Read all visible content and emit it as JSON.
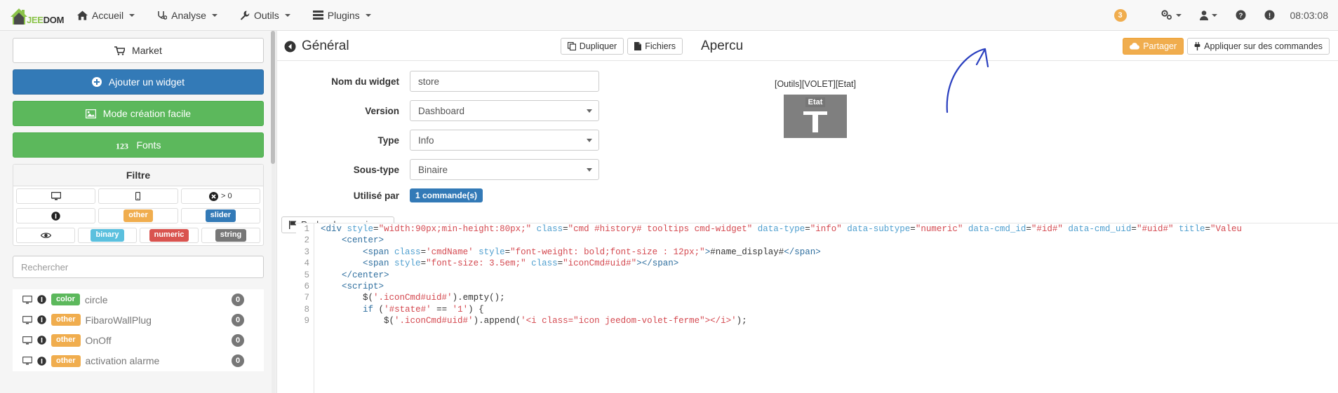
{
  "navbar": {
    "brand": {
      "text_green": "JEE",
      "text_dark": "DOM",
      "icon": "house-logo-icon"
    },
    "items": [
      {
        "label": "Accueil",
        "icon": "home-icon",
        "caret": true
      },
      {
        "label": "Analyse",
        "icon": "stethoscope-icon",
        "caret": true
      },
      {
        "label": "Outils",
        "icon": "wrench-icon",
        "caret": true
      },
      {
        "label": "Plugins",
        "icon": "list-icon",
        "caret": true
      }
    ],
    "notification_count": "3",
    "right_icons": [
      {
        "name": "gears-icon",
        "caret": true
      },
      {
        "name": "user-icon",
        "caret": true
      },
      {
        "name": "question-circle-icon",
        "caret": false
      },
      {
        "name": "exclamation-circle-icon",
        "caret": false
      }
    ],
    "clock": "08:03:08"
  },
  "sidebar": {
    "buttons": [
      {
        "label": "Market",
        "icon": "cart-icon",
        "style": "default"
      },
      {
        "label": "Ajouter un widget",
        "icon": "plus-circle-icon",
        "style": "primary"
      },
      {
        "label": "Mode création facile",
        "icon": "image-icon",
        "style": "success"
      },
      {
        "label": "Fonts",
        "icon": "font-123-icon",
        "style": "success"
      }
    ],
    "filter": {
      "title": "Filtre",
      "rows": [
        [
          {
            "type": "icon",
            "icon": "desktop-icon"
          },
          {
            "type": "icon",
            "icon": "mobile-icon"
          },
          {
            "type": "icon-text",
            "icon": "times-circle-icon",
            "text": "> 0"
          }
        ],
        [
          {
            "type": "icon",
            "icon": "info-circle-icon"
          },
          {
            "type": "label",
            "text": "other",
            "color": "#f0ad4e"
          },
          {
            "type": "label",
            "text": "slider",
            "color": "#337ab7"
          }
        ],
        [
          {
            "type": "icon",
            "icon": "eye-icon"
          },
          {
            "type": "label",
            "text": "binary",
            "color": "#5bc0de"
          },
          {
            "type": "label",
            "text": "numeric",
            "color": "#d9534f"
          },
          {
            "type": "label",
            "text": "string",
            "color": "#777777"
          }
        ]
      ]
    },
    "search": {
      "placeholder": "Rechercher",
      "value": ""
    },
    "widgets": [
      {
        "device_icon": "desktop-icon",
        "type_icon": "info-circle-icon",
        "label": "color",
        "label_color": "#5cb85c",
        "name": "circle",
        "count": "0"
      },
      {
        "device_icon": "desktop-icon",
        "type_icon": "info-circle-icon",
        "label": "other",
        "label_color": "#f0ad4e",
        "name": "FibaroWallPlug",
        "count": "0"
      },
      {
        "device_icon": "desktop-icon",
        "type_icon": "info-circle-icon",
        "label": "other",
        "label_color": "#f0ad4e",
        "name": "OnOff",
        "count": "0"
      },
      {
        "device_icon": "desktop-icon",
        "type_icon": "info-circle-icon",
        "label": "other",
        "label_color": "#f0ad4e",
        "name": "activation alarme",
        "count": "0"
      }
    ]
  },
  "general": {
    "title": "Général",
    "back_icon": "arrow-circle-left-icon",
    "buttons": [
      {
        "label": "Dupliquer",
        "icon": "copy-icon"
      },
      {
        "label": "Fichiers",
        "icon": "file-icon"
      }
    ],
    "fields": [
      {
        "label": "Nom du widget",
        "control": "input",
        "value": "store"
      },
      {
        "label": "Version",
        "control": "select",
        "value": "Dashboard"
      },
      {
        "label": "Type",
        "control": "select",
        "value": "Info"
      },
      {
        "label": "Sous-type",
        "control": "select",
        "value": "Binaire"
      },
      {
        "label": "Utilisé par",
        "control": "badge",
        "value": "1 commande(s)"
      }
    ],
    "icon_search_button": {
      "label": "Rechercher une icone",
      "icon": "flag-icon"
    },
    "code": {
      "lines": [
        {
          "n": "1",
          "html": "<span class=\"ctag\">&lt;div</span> <span class=\"cattr\">style</span><span class=\"cpunct\">=</span><span class=\"cstr\">\"width:90px;min-height:80px;\"</span> <span class=\"cattr\">class</span><span class=\"cpunct\">=</span><span class=\"cstr\">\"cmd #history# tooltips cmd-widget\"</span> <span class=\"cattr\">data-type</span><span class=\"cpunct\">=</span><span class=\"cstr\">\"info\"</span> <span class=\"cattr\">data-subtype</span><span class=\"cpunct\">=</span><span class=\"cstr\">\"numeric\"</span> <span class=\"cattr\">data-cmd_id</span><span class=\"cpunct\">=</span><span class=\"cstr\">\"#id#\"</span> <span class=\"cattr\">data-cmd_uid</span><span class=\"cpunct\">=</span><span class=\"cstr\">\"#uid#\"</span> <span class=\"cattr\">title</span><span class=\"cpunct\">=</span><span class=\"cstr\">\"Valeu</span>"
        },
        {
          "n": "2",
          "html": "    <span class=\"ctag\">&lt;center&gt;</span>"
        },
        {
          "n": "3",
          "html": "        <span class=\"ctag\">&lt;span</span> <span class=\"cattr\">class</span><span class=\"cpunct\">=</span><span class=\"cstr\">'cmdName'</span> <span class=\"cattr\">style</span><span class=\"cpunct\">=</span><span class=\"cstr\">\"font-weight: bold;font-size : 12px;\"</span><span class=\"ctag\">&gt;</span><span class=\"cplain\">#name_display#</span><span class=\"ctag\">&lt;/span&gt;</span>"
        },
        {
          "n": "4",
          "html": "        <span class=\"ctag\">&lt;span</span> <span class=\"cattr\">style</span><span class=\"cpunct\">=</span><span class=\"cstr\">\"font-size: 3.5em;\"</span> <span class=\"cattr\">class</span><span class=\"cpunct\">=</span><span class=\"cstr\">\"iconCmd#uid#\"</span><span class=\"ctag\">&gt;&lt;/span&gt;</span>"
        },
        {
          "n": "5",
          "html": "    <span class=\"ctag\">&lt;/center&gt;</span>"
        },
        {
          "n": "6",
          "html": "    <span class=\"ctag\">&lt;script&gt;</span>"
        },
        {
          "n": "7",
          "html": "        <span class=\"cplain\">$(</span><span class=\"cstr\">'.iconCmd#uid#'</span><span class=\"cplain\">).empty();</span>"
        },
        {
          "n": "8",
          "html": "        <span class=\"ckw\">if</span> <span class=\"cplain\">(</span><span class=\"cstr\">'#state#'</span> <span class=\"cplain\">==</span> <span class=\"cstr\">'1'</span><span class=\"cplain\">) {</span>"
        },
        {
          "n": "9",
          "html": "            <span class=\"cplain\">$(</span><span class=\"cstr\">'.iconCmd#uid#'</span><span class=\"cplain\">).append(</span><span class=\"cstr\">'&lt;i class=\"icon jeedom-volet-ferme\"&gt;&lt;/i&gt;'</span><span class=\"cplain\">);</span>"
        }
      ]
    }
  },
  "apercu": {
    "title": "Apercu",
    "buttons": [
      {
        "label": "Partager",
        "icon": "cloud-icon",
        "style": "warning"
      },
      {
        "label": "Appliquer sur des commandes",
        "icon": "plug-icon",
        "style": "default"
      }
    ],
    "preview": {
      "path": "[Outils][VOLET][Etat]",
      "tile_label": "Etat",
      "tile_color": "#7f7f7f",
      "tile_icon": "shutter-closed-icon"
    }
  },
  "annotation": {
    "shape": "hand-drawn-arrow",
    "color": "#2a3fbf"
  }
}
